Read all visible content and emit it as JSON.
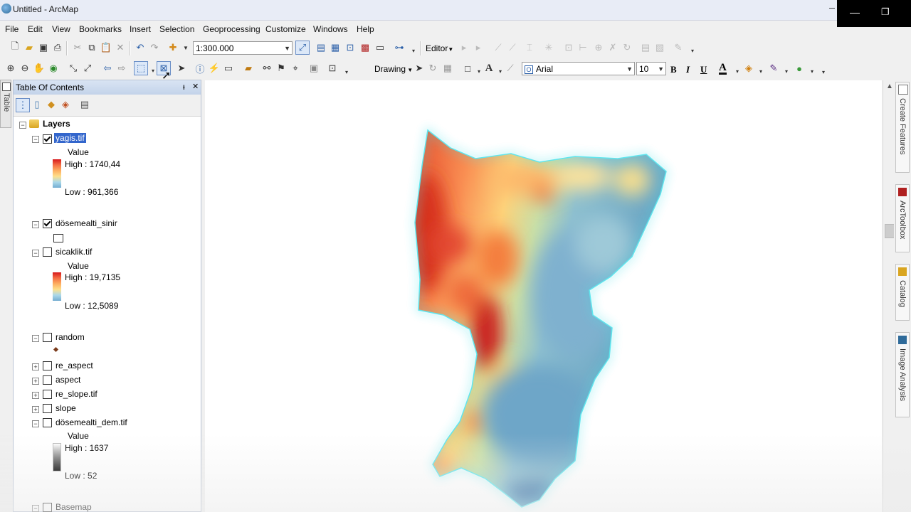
{
  "window": {
    "title": "Untitled - ArcMap",
    "minimize": "—",
    "restore": "❐"
  },
  "menu": [
    "File",
    "Edit",
    "View",
    "Bookmarks",
    "Insert",
    "Selection",
    "Geoprocessing",
    "Customize",
    "Windows",
    "Help"
  ],
  "standard_toolbar": {
    "scale": "1:300.000",
    "editor_label": "Editor"
  },
  "drawing_toolbar": {
    "drawing_label": "Drawing",
    "font_name": "Arial",
    "font_size": "10",
    "bold": "B",
    "italic": "I",
    "underline": "U",
    "font_color": "A"
  },
  "left_dock": {
    "tab_label": "Table"
  },
  "toc": {
    "title": "Table Of Contents",
    "pin": "ᵻ",
    "close": "✕",
    "root": "Layers",
    "layers": [
      {
        "name": "yagis.tif",
        "checked": true,
        "selected": true,
        "legend": {
          "heading": "Value",
          "high": "High : 1740,44",
          "low": "Low : 961,366"
        }
      },
      {
        "name": "dösemealti_sinir",
        "checked": true
      },
      {
        "name": "sicaklik.tif",
        "checked": false,
        "legend": {
          "heading": "Value",
          "high": "High : 19,7135",
          "low": "Low : 12,5089"
        }
      },
      {
        "name": "random",
        "checked": false
      },
      {
        "name": "re_aspect",
        "checked": false
      },
      {
        "name": "aspect",
        "checked": false
      },
      {
        "name": "re_slope.tif",
        "checked": false
      },
      {
        "name": "slope",
        "checked": false
      },
      {
        "name": "dösemealti_dem.tif",
        "checked": false,
        "legend": {
          "heading": "Value",
          "high": "High : 1637",
          "low": "Low : 52"
        }
      },
      {
        "name": "Basemap",
        "checked": false
      }
    ]
  },
  "right_dock": {
    "tabs": [
      "Create Features",
      "ArcToolbox",
      "Catalog",
      "Image Analysis"
    ]
  },
  "colors": {
    "accent_selection": "#3366cc",
    "boundary": "#4fe0e8",
    "high": "#d7191c",
    "low": "#2c7bb6"
  }
}
